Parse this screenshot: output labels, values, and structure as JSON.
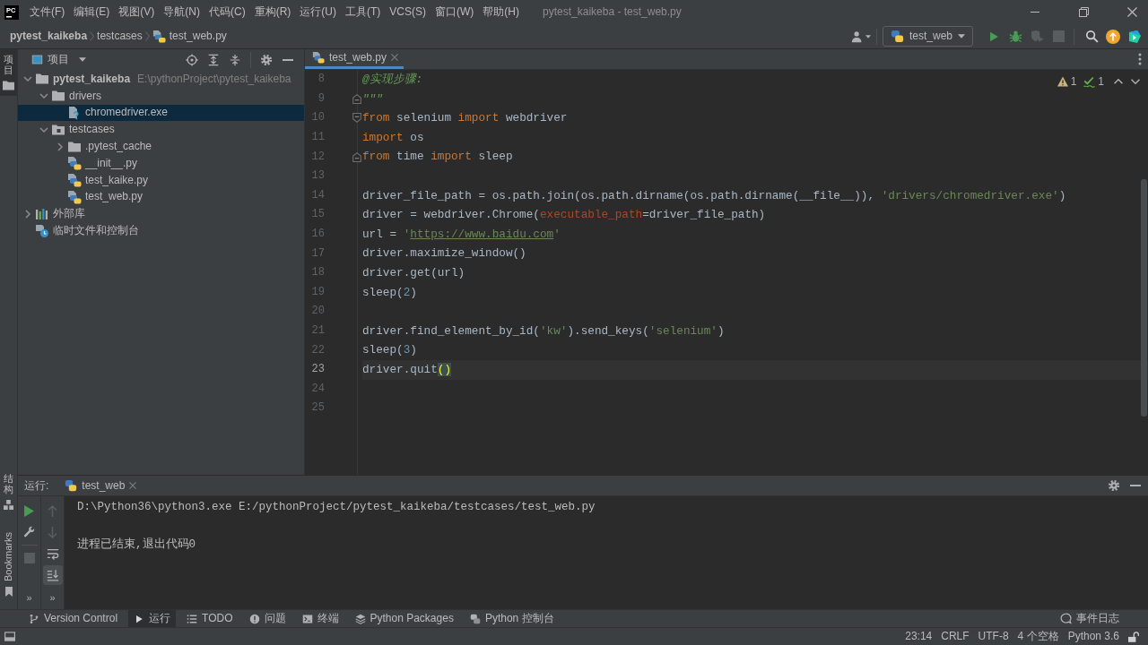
{
  "window": {
    "logo": "PC",
    "title": "pytest_kaikeba - test_web.py"
  },
  "menu": [
    "文件(F)",
    "编辑(E)",
    "视图(V)",
    "导航(N)",
    "代码(C)",
    "重构(R)",
    "运行(U)",
    "工具(T)",
    "VCS(S)",
    "窗口(W)",
    "帮助(H)"
  ],
  "breadcrumb": [
    {
      "label": "pytest_kaikeba",
      "kind": "project"
    },
    {
      "label": "testcases",
      "kind": "folder"
    },
    {
      "label": "test_web.py",
      "kind": "python"
    }
  ],
  "run_config": {
    "label": "test_web"
  },
  "run_toolbar": [
    {
      "kind": "run",
      "disabled": false
    },
    {
      "kind": "debug",
      "disabled": false
    },
    {
      "kind": "coverage",
      "disabled": true
    },
    {
      "kind": "stop",
      "disabled": true
    }
  ],
  "side_stripe": {
    "top": [
      {
        "label": "项目",
        "kind": "project",
        "selected": true
      }
    ],
    "bottom": [
      {
        "label": "结构",
        "kind": "structure",
        "selected": false
      },
      {
        "label": "Bookmarks",
        "kind": "bookmarks",
        "selected": false
      }
    ]
  },
  "project_panel": {
    "title": "项目",
    "tree": [
      {
        "label": "pytest_kaikeba",
        "path": "E:\\pythonProject\\pytest_kaikeba",
        "kind": "project_root",
        "expanded": true,
        "selected": false,
        "children": [
          {
            "label": "drivers",
            "kind": "folder",
            "expanded": true,
            "selected": false,
            "children": [
              {
                "label": "chromedriver.exe",
                "kind": "unknown_file",
                "selected": true
              }
            ]
          },
          {
            "label": "testcases",
            "kind": "package",
            "expanded": true,
            "selected": false,
            "children": [
              {
                "label": ".pytest_cache",
                "kind": "folder",
                "expanded": false,
                "selected": false
              },
              {
                "label": "__init__.py",
                "kind": "python_file",
                "selected": false
              },
              {
                "label": "test_kaike.py",
                "kind": "python_file",
                "selected": false
              },
              {
                "label": "test_web.py",
                "kind": "python_file",
                "selected": false
              }
            ]
          }
        ]
      },
      {
        "label": "外部库",
        "kind": "library",
        "expanded": false,
        "selected": false
      },
      {
        "label": "临时文件和控制台",
        "kind": "scratches",
        "selected": false
      }
    ]
  },
  "editor": {
    "tabs": [
      {
        "label": "test_web.py",
        "selected": true
      }
    ],
    "inspections": {
      "warnings": "1",
      "weak_warnings": "1"
    },
    "lines": [
      {
        "number": "8",
        "current": false,
        "tokens": [
          {
            "kind": "docstring",
            "text": "@实现步骤:"
          }
        ]
      },
      {
        "number": "9",
        "current": false,
        "fold_end": true,
        "tokens": [
          {
            "kind": "docstring",
            "text": "\"\"\""
          }
        ]
      },
      {
        "number": "10",
        "current": false,
        "fold_start": true,
        "tokens": [
          {
            "kind": "keyword",
            "text": "from"
          },
          {
            "kind": "plain",
            "text": " selenium "
          },
          {
            "kind": "keyword",
            "text": "import"
          },
          {
            "kind": "plain",
            "text": " webdriver"
          }
        ]
      },
      {
        "number": "11",
        "current": false,
        "tokens": [
          {
            "kind": "keyword",
            "text": "import"
          },
          {
            "kind": "plain",
            "text": " os"
          }
        ]
      },
      {
        "number": "12",
        "current": false,
        "fold_end": true,
        "tokens": [
          {
            "kind": "keyword",
            "text": "from"
          },
          {
            "kind": "plain",
            "text": " time "
          },
          {
            "kind": "keyword",
            "text": "import"
          },
          {
            "kind": "plain",
            "text": " sleep"
          }
        ]
      },
      {
        "number": "13",
        "current": false
      },
      {
        "number": "14",
        "current": false,
        "tokens": [
          {
            "kind": "plain",
            "text": "driver_file_path = os.path.join(os.path.dirname(os.path.dirname(__file__)), "
          },
          {
            "kind": "string",
            "text": "'drivers/chromedriver.exe'"
          },
          {
            "kind": "plain",
            "text": ")"
          }
        ]
      },
      {
        "number": "15",
        "current": false,
        "tokens": [
          {
            "kind": "plain",
            "text": "driver = webdriver.Chrome("
          },
          {
            "kind": "param",
            "text": "executable_path"
          },
          {
            "kind": "plain",
            "text": "=driver_file_path)"
          }
        ]
      },
      {
        "number": "16",
        "current": false,
        "tokens": [
          {
            "kind": "plain",
            "text": "url = "
          },
          {
            "kind": "string",
            "text": "'"
          },
          {
            "kind": "link",
            "text": "https://www.baidu.com"
          },
          {
            "kind": "string",
            "text": "'"
          }
        ]
      },
      {
        "number": "17",
        "current": false,
        "tokens": [
          {
            "kind": "plain",
            "text": "driver.maximize_window()"
          }
        ]
      },
      {
        "number": "18",
        "current": false,
        "tokens": [
          {
            "kind": "plain",
            "text": "driver.get(url)"
          }
        ]
      },
      {
        "number": "19",
        "current": false,
        "tokens": [
          {
            "kind": "plain",
            "text": "sleep("
          },
          {
            "kind": "number",
            "text": "2"
          },
          {
            "kind": "plain",
            "text": ")"
          }
        ]
      },
      {
        "number": "20",
        "current": false
      },
      {
        "number": "21",
        "current": false,
        "tokens": [
          {
            "kind": "plain",
            "text": "driver.find_element_by_id("
          },
          {
            "kind": "string",
            "text": "'kw'"
          },
          {
            "kind": "plain",
            "text": ").send_keys("
          },
          {
            "kind": "string",
            "text": "'selenium'"
          },
          {
            "kind": "plain",
            "text": ")"
          }
        ]
      },
      {
        "number": "22",
        "current": false,
        "tokens": [
          {
            "kind": "plain",
            "text": "sleep("
          },
          {
            "kind": "number",
            "text": "3"
          },
          {
            "kind": "plain",
            "text": ")"
          }
        ]
      },
      {
        "number": "23",
        "current": true,
        "tokens": [
          {
            "kind": "plain",
            "text": "driver.quit"
          },
          {
            "kind": "brace_match",
            "text": "()"
          }
        ]
      },
      {
        "number": "24",
        "current": false
      },
      {
        "number": "25",
        "current": false
      }
    ]
  },
  "run_panel": {
    "label": "运行:",
    "tabs": [
      {
        "label": "test_web"
      }
    ],
    "toolbar": [
      [
        {
          "kind": "rerun",
          "disabled": false
        },
        {
          "kind": "edit_config",
          "disabled": false
        },
        {
          "kind": "stop",
          "disabled": true
        },
        {
          "kind": "more",
          "label": "»"
        }
      ],
      [
        {
          "kind": "up",
          "disabled": true
        },
        {
          "kind": "down",
          "disabled": true
        },
        {
          "kind": "soft_wrap",
          "on": false
        },
        {
          "kind": "scroll_to_end",
          "on": true
        },
        {
          "kind": "more",
          "label": "»"
        }
      ]
    ],
    "output": [
      "D:\\Python36\\python3.exe E:/pythonProject/pytest_kaikeba/testcases/test_web.py",
      "进程已结束,退出代码0"
    ]
  },
  "tool_windows": [
    {
      "label": "Version Control",
      "kind": "vcs",
      "selected": false
    },
    {
      "label": "运行",
      "kind": "run",
      "selected": true
    },
    {
      "label": "TODO",
      "kind": "todo",
      "selected": false
    },
    {
      "label": "问题",
      "kind": "problems",
      "selected": false
    },
    {
      "label": "终端",
      "kind": "terminal",
      "selected": false
    },
    {
      "label": "Python Packages",
      "kind": "packages",
      "selected": false
    },
    {
      "label": "Python 控制台",
      "kind": "console",
      "selected": false
    }
  ],
  "event_log": "事件日志",
  "status_bar": [
    "23:14",
    "CRLF",
    "UTF-8",
    "4 个空格",
    "Python 3.6"
  ]
}
